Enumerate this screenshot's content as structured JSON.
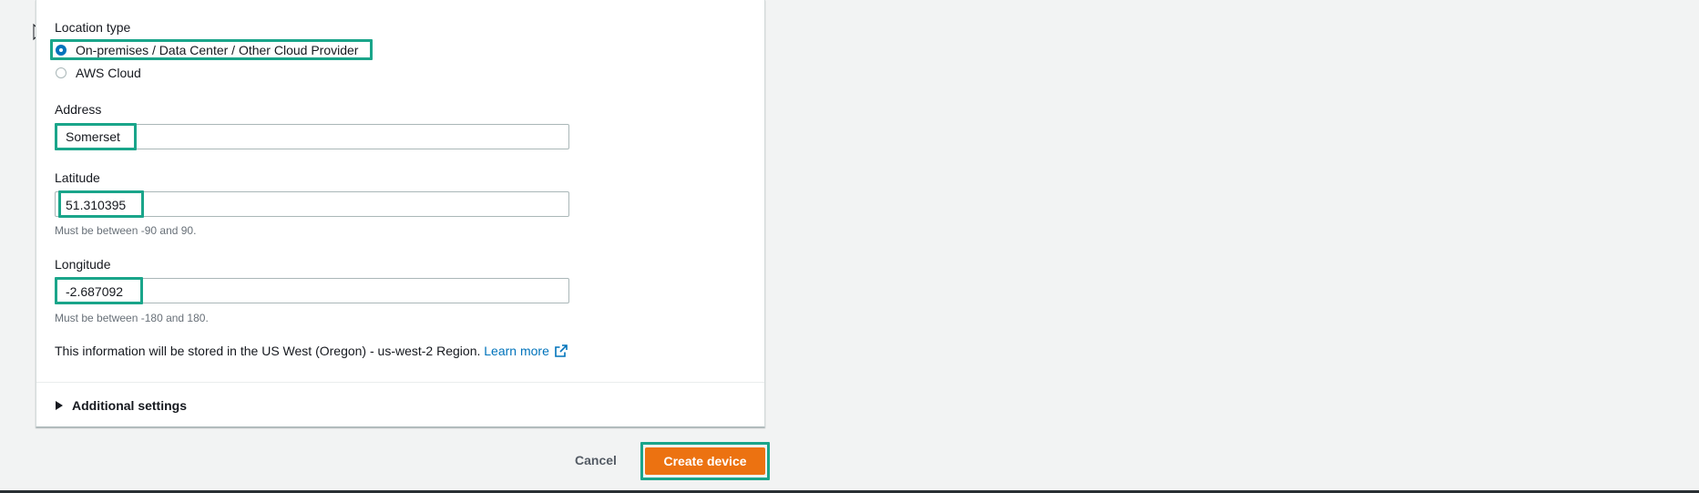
{
  "location_type": {
    "label": "Location type",
    "options": [
      {
        "label": "On-premises / Data Center / Other Cloud Provider",
        "selected": true
      },
      {
        "label": "AWS Cloud",
        "selected": false
      }
    ]
  },
  "address": {
    "label": "Address",
    "value": "Somerset"
  },
  "latitude": {
    "label": "Latitude",
    "value": "51.310395",
    "hint": "Must be between -90 and 90."
  },
  "longitude": {
    "label": "Longitude",
    "value": "-2.687092",
    "hint": "Must be between -180 and 180."
  },
  "info": {
    "text": "This information will be stored in the US West (Oregon) - us-west-2 Region.",
    "link_label": "Learn more"
  },
  "additional_settings": {
    "label": "Additional settings"
  },
  "actions": {
    "cancel_label": "Cancel",
    "create_label": "Create device"
  },
  "colors": {
    "highlight": "#1aa58a",
    "primary": "#ec7211",
    "radio_selected": "#0073bb",
    "link": "#0073bb"
  },
  "icons": {
    "cursor": "mouse-pointer-icon",
    "external_link": "external-link-icon",
    "caret": "caret-right-icon"
  }
}
